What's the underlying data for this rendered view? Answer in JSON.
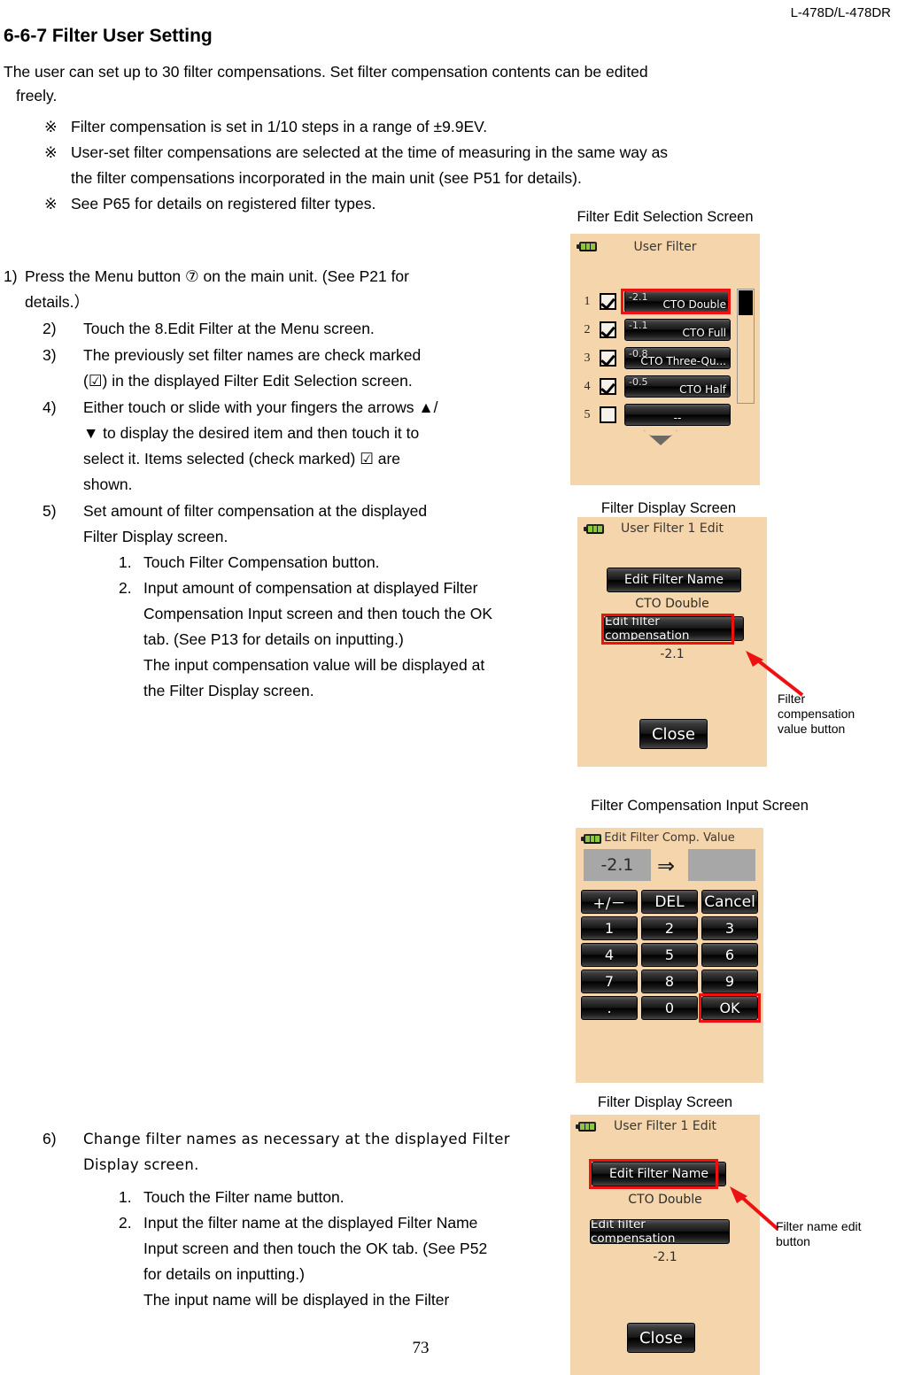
{
  "document": {
    "header_model": "L-478D/L-478DR",
    "section_title": "6-6-7 Filter User Setting",
    "intro_line1": "The user can set up to 30 filter compensations. Set filter compensation contents can be edited",
    "intro_line2": "freely.",
    "page_number": "73"
  },
  "notes": [
    {
      "mark": "※",
      "line1": "Filter compensation is set in 1/10 steps in a range of  ±9.9EV.",
      "line2": ""
    },
    {
      "mark": "※",
      "line1": "User-set filter compensations are selected at the time of measuring in the same way as",
      "line2": "the filter compensations incorporated in the main unit (see P51 for details)."
    },
    {
      "mark": "※",
      "line1": "See P65 for details on registered filter types.",
      "line2": ""
    }
  ],
  "steps": {
    "step1": {
      "num": "1)",
      "line1": "Press the Menu button  ⑦  on the main unit. (See P21 for",
      "line2": "details.）"
    },
    "step2": {
      "num": "2)",
      "line1": "Touch the 8.Edit Filter at the Menu screen."
    },
    "step3": {
      "num": "3)",
      "line1": "The previously set filter names are check marked",
      "line2": "(☑) in the displayed Filter Edit Selection screen."
    },
    "step4": {
      "num": "4)",
      "line1": "Either touch or slide with your fingers the arrows  ▲/",
      "line2": "▼  to display the desired item and then touch it to",
      "line3": "select it. Items selected (check marked)  ☑  are",
      "line4": "shown."
    },
    "step5": {
      "num": "5)",
      "line1": "Set amount of filter compensation at the displayed",
      "line2": "Filter Display screen.",
      "sub1": {
        "num": "1.",
        "line1": "Touch Filter Compensation button."
      },
      "sub2": {
        "num": "2.",
        "line1": "Input amount of compensation at displayed Filter",
        "line2": "Compensation Input screen and then touch the OK",
        "line3": "tab. (See P13 for details on inputting.)",
        "line4": "The input compensation value will be displayed at",
        "line5": "the Filter Display screen."
      }
    },
    "step6": {
      "num": "6)",
      "line1": "Change filter names as necessary at the displayed Filter",
      "line2": "Display screen.",
      "sub1": {
        "num": "1.",
        "line1": "Touch the Filter name button."
      },
      "sub2": {
        "num": "2.",
        "line1": "Input the filter name at the displayed Filter Name",
        "line2": "Input screen and then touch the OK tab. (See P52",
        "line3": "for details on inputting.)",
        "line4": "The input name will be displayed in the Filter"
      }
    }
  },
  "screens": {
    "edit_selection": {
      "caption": "Filter Edit Selection Screen",
      "title": "User Filter",
      "rows": [
        {
          "index": "1",
          "checked": true,
          "value": "-2.1",
          "name": "CTO Double",
          "selected": true
        },
        {
          "index": "2",
          "checked": true,
          "value": "-1.1",
          "name": "CTO Full",
          "selected": false
        },
        {
          "index": "3",
          "checked": true,
          "value": "-0.8",
          "name": "CTO Three-Qu...",
          "selected": false
        },
        {
          "index": "4",
          "checked": true,
          "value": "-0.5",
          "name": "CTO Half",
          "selected": false
        },
        {
          "index": "5",
          "checked": false,
          "value": "",
          "name": "--",
          "selected": false
        }
      ]
    },
    "filter_display_top": {
      "caption": "Filter Display Screen",
      "title": "User  Filter  1  Edit",
      "name_button": "Edit Filter Name",
      "name_value": "CTO Double",
      "comp_button": "Edit filter compensation",
      "comp_value": "-2.1",
      "close_button": "Close",
      "annotation": "Filter\ncompensation\nvalue button",
      "annotation_lines": [
        "Filter",
        "compensation",
        "value button"
      ],
      "highlight": "comp_button"
    },
    "comp_input": {
      "caption": "Filter Compensation Input Screen",
      "title": "Edit Filter Comp. Value",
      "current_value": "-2.1",
      "new_value": "",
      "arrow": "⇒",
      "keys": [
        [
          "+/－",
          "DEL",
          "Cancel"
        ],
        [
          "1",
          "2",
          "3"
        ],
        [
          "4",
          "5",
          "6"
        ],
        [
          "7",
          "8",
          "9"
        ],
        [
          ".",
          "0",
          "OK"
        ]
      ],
      "highlight_key": "OK"
    },
    "filter_display_bottom": {
      "caption": "Filter Display Screen",
      "title": "User  Filter  1  Edit",
      "name_button": "Edit Filter Name",
      "name_value": "CTO Double",
      "comp_button": "Edit filter compensation",
      "comp_value": "-2.1",
      "close_button": "Close",
      "annotation_lines": [
        "Filter   name   edit",
        "button"
      ],
      "annotation_line1": "Filter    name    edit",
      "annotation_line2": "button",
      "highlight": "name_button"
    }
  },
  "colors": {
    "screen_bg": "#f5d5ab",
    "highlight_red": "#ee1111",
    "battery_green": "#8ec641",
    "button_dark": "#000000",
    "value_box": "#a7a7a7"
  }
}
